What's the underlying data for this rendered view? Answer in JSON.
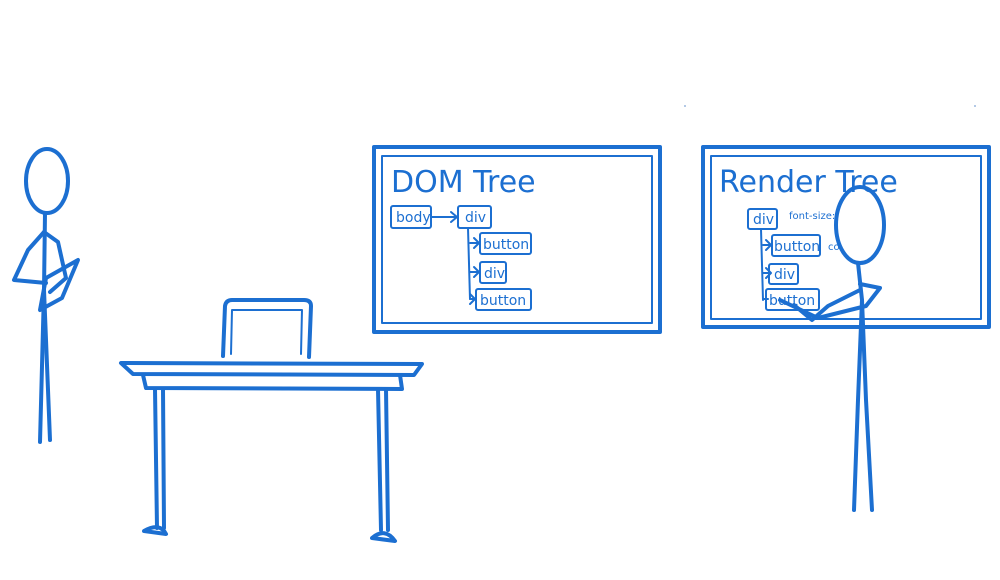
{
  "colors": {
    "ink": "#1c6fd1",
    "background": "#ffffff"
  },
  "dom_board": {
    "title": "DOM Tree",
    "nodes": {
      "body": "body",
      "div1": "div",
      "button1": "button",
      "div2": "div",
      "button2": "button"
    }
  },
  "render_board": {
    "title": "Render Tree",
    "nodes": {
      "div1": "div",
      "button1": "button",
      "div2": "div",
      "button2": "button"
    },
    "notes": {
      "font_size": "font-size:",
      "cut_off": "co"
    }
  }
}
